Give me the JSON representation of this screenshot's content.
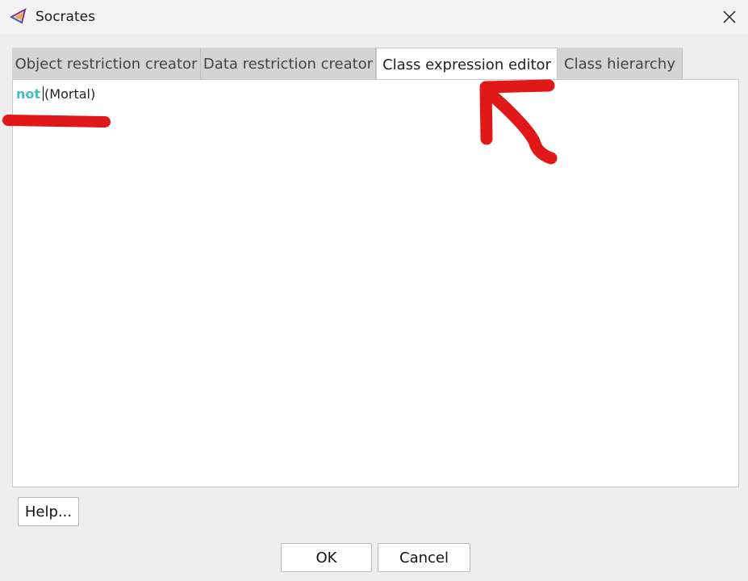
{
  "window": {
    "title": "Socrates",
    "app_icon": "socrates-logo-icon",
    "close_icon": "close-icon"
  },
  "tabs": [
    {
      "label": "Object restriction creator",
      "active": false
    },
    {
      "label": "Data restriction creator",
      "active": false
    },
    {
      "label": "Class expression editor",
      "active": true
    },
    {
      "label": "Class hierarchy",
      "active": false
    }
  ],
  "editor": {
    "keyword": "not",
    "expression": "(Mortal)",
    "keyword_color": "#3cc2c2"
  },
  "buttons": {
    "help": "Help...",
    "ok": "OK",
    "cancel": "Cancel"
  },
  "annotations": {
    "color": "#e01818"
  }
}
